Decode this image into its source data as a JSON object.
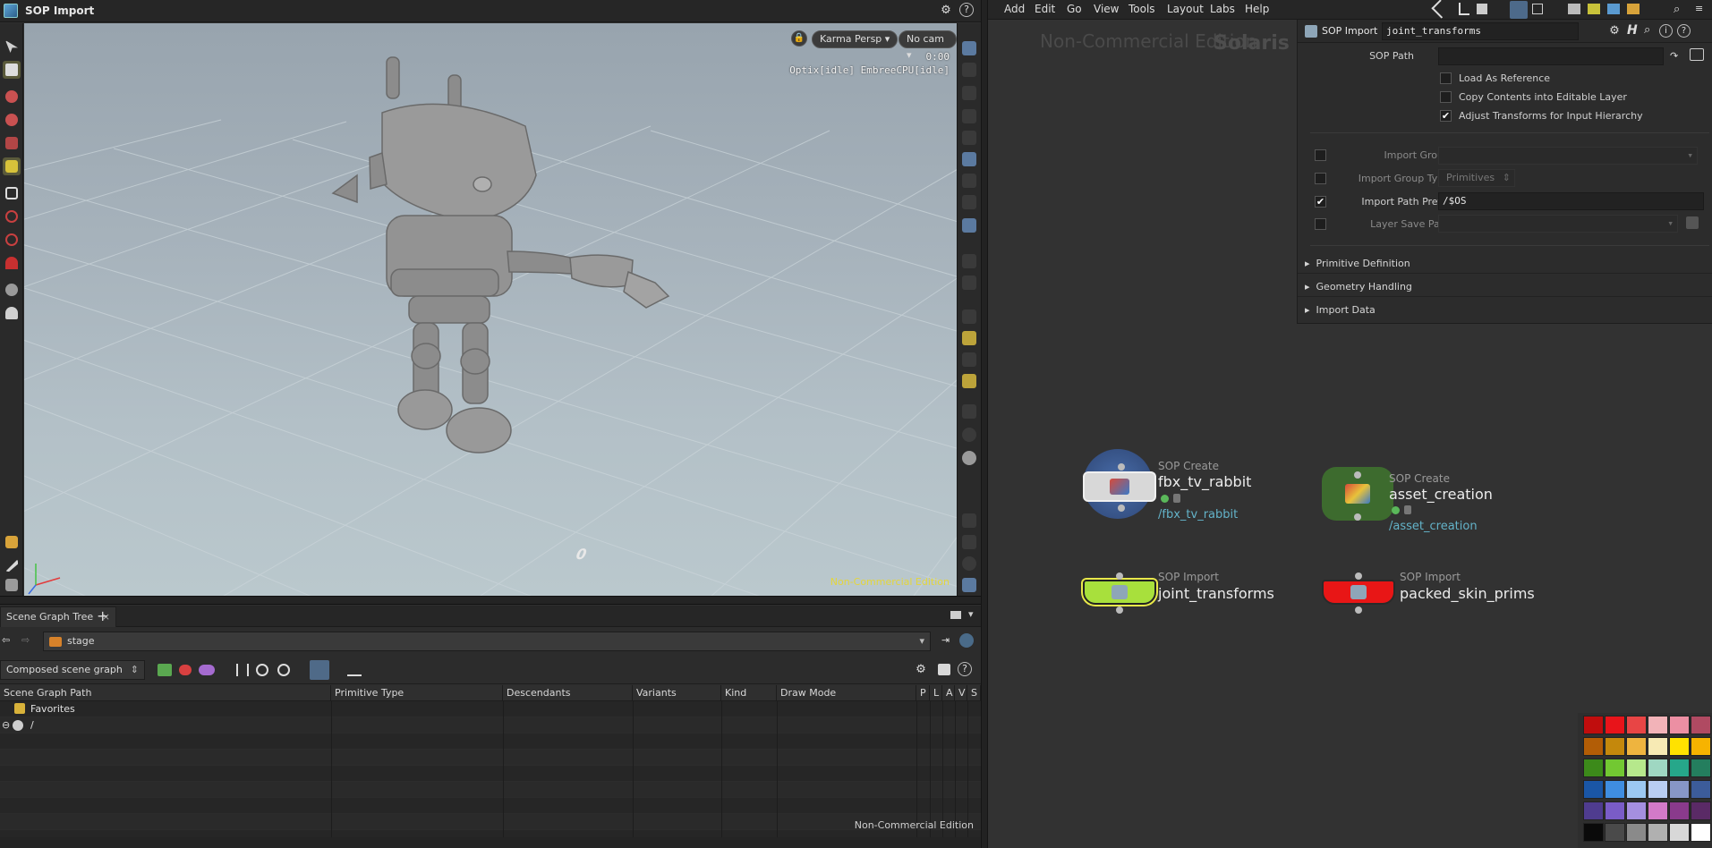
{
  "left_pane": {
    "title": "SOP Import",
    "viewport": {
      "renderer_label": "Karma Persp",
      "camera_label": "No cam",
      "time": "0:00",
      "status": "Optix[idle] EmbreeCPU[idle]",
      "watermark": "Non-Commercial Edition",
      "grid_number": "0"
    }
  },
  "scene_graph": {
    "tab_label": "Scene Graph Tree",
    "stage_path": "stage",
    "mode_select": "Composed scene graph",
    "columns": [
      "Scene Graph Path",
      "Primitive Type",
      "Descendants",
      "Variants",
      "Kind",
      "Draw Mode",
      "P",
      "L",
      "A",
      "V",
      "S"
    ],
    "rows": [
      {
        "path": "Favorites"
      },
      {
        "path": "/"
      }
    ],
    "watermark": "Non-Commercial Edition"
  },
  "menubar": {
    "items": [
      "Add",
      "Edit",
      "Go",
      "View",
      "Tools",
      "Layout",
      "Labs",
      "Help"
    ]
  },
  "network": {
    "bg_label_left": "Non-Commercial Edition",
    "bg_label_right": "Solaris",
    "nodes": [
      {
        "type": "SOP Create",
        "name": "fbx_tv_rabbit",
        "path": "/fbx_tv_rabbit"
      },
      {
        "type": "SOP Create",
        "name": "asset_creation",
        "path": "/asset_creation"
      },
      {
        "type": "SOP Import",
        "name": "joint_transforms"
      },
      {
        "type": "SOP Import",
        "name": "packed_skin_prims"
      }
    ]
  },
  "params": {
    "node_type": "SOP Import",
    "node_name": "joint_transforms",
    "sop_path_label": "SOP Path",
    "sop_path_value": "",
    "load_as_reference": "Load As Reference",
    "copy_contents": "Copy Contents into Editable Layer",
    "adjust_transforms": "Adjust Transforms for Input Hierarchy",
    "import_group": "Import Group",
    "import_group_type": "Import Group Type",
    "import_group_type_value": "Primitives",
    "import_path_prefix": "Import Path Prefix",
    "import_path_prefix_value": "/$OS",
    "layer_save_path": "Layer Save Path",
    "folders": [
      "Primitive Definition",
      "Geometry Handling",
      "Import Data"
    ],
    "checks": {
      "load_as_reference": false,
      "copy_contents": false,
      "adjust_transforms": true,
      "import_group": false,
      "import_group_type": false,
      "import_path_prefix": true,
      "layer_save_path": false
    }
  },
  "colors": {
    "selected_node": "#a8e03c",
    "display_node": "#e81616",
    "path_text": "#63b3c9",
    "watermark_viewport": "#e4d63a"
  },
  "palette": [
    [
      "#c00d0d",
      "#e8141a",
      "#e84545",
      "#f2b3b8",
      "#ec8fa3",
      "#b04a62"
    ],
    [
      "#b25d06",
      "#c4880c",
      "#eeb43f",
      "#f7eab4",
      "#ffe200",
      "#f7b300"
    ],
    [
      "#3c8a1a",
      "#72c832",
      "#b6e88c",
      "#9fd7c2",
      "#26a78a",
      "#247e5e"
    ],
    [
      "#1a56a6",
      "#3f8de0",
      "#9cc8f2",
      "#b9cdf2",
      "#8796c7",
      "#3c5c9a"
    ],
    [
      "#4f3c8f",
      "#7a5cc7",
      "#a58fe0",
      "#d37ac8",
      "#8a3a8c",
      "#5a2a66"
    ],
    [
      "#0a0a0a",
      "#4a4a4a",
      "#8a8a8a",
      "#b0b0b0",
      "#d8d8d8",
      "#ffffff"
    ]
  ]
}
